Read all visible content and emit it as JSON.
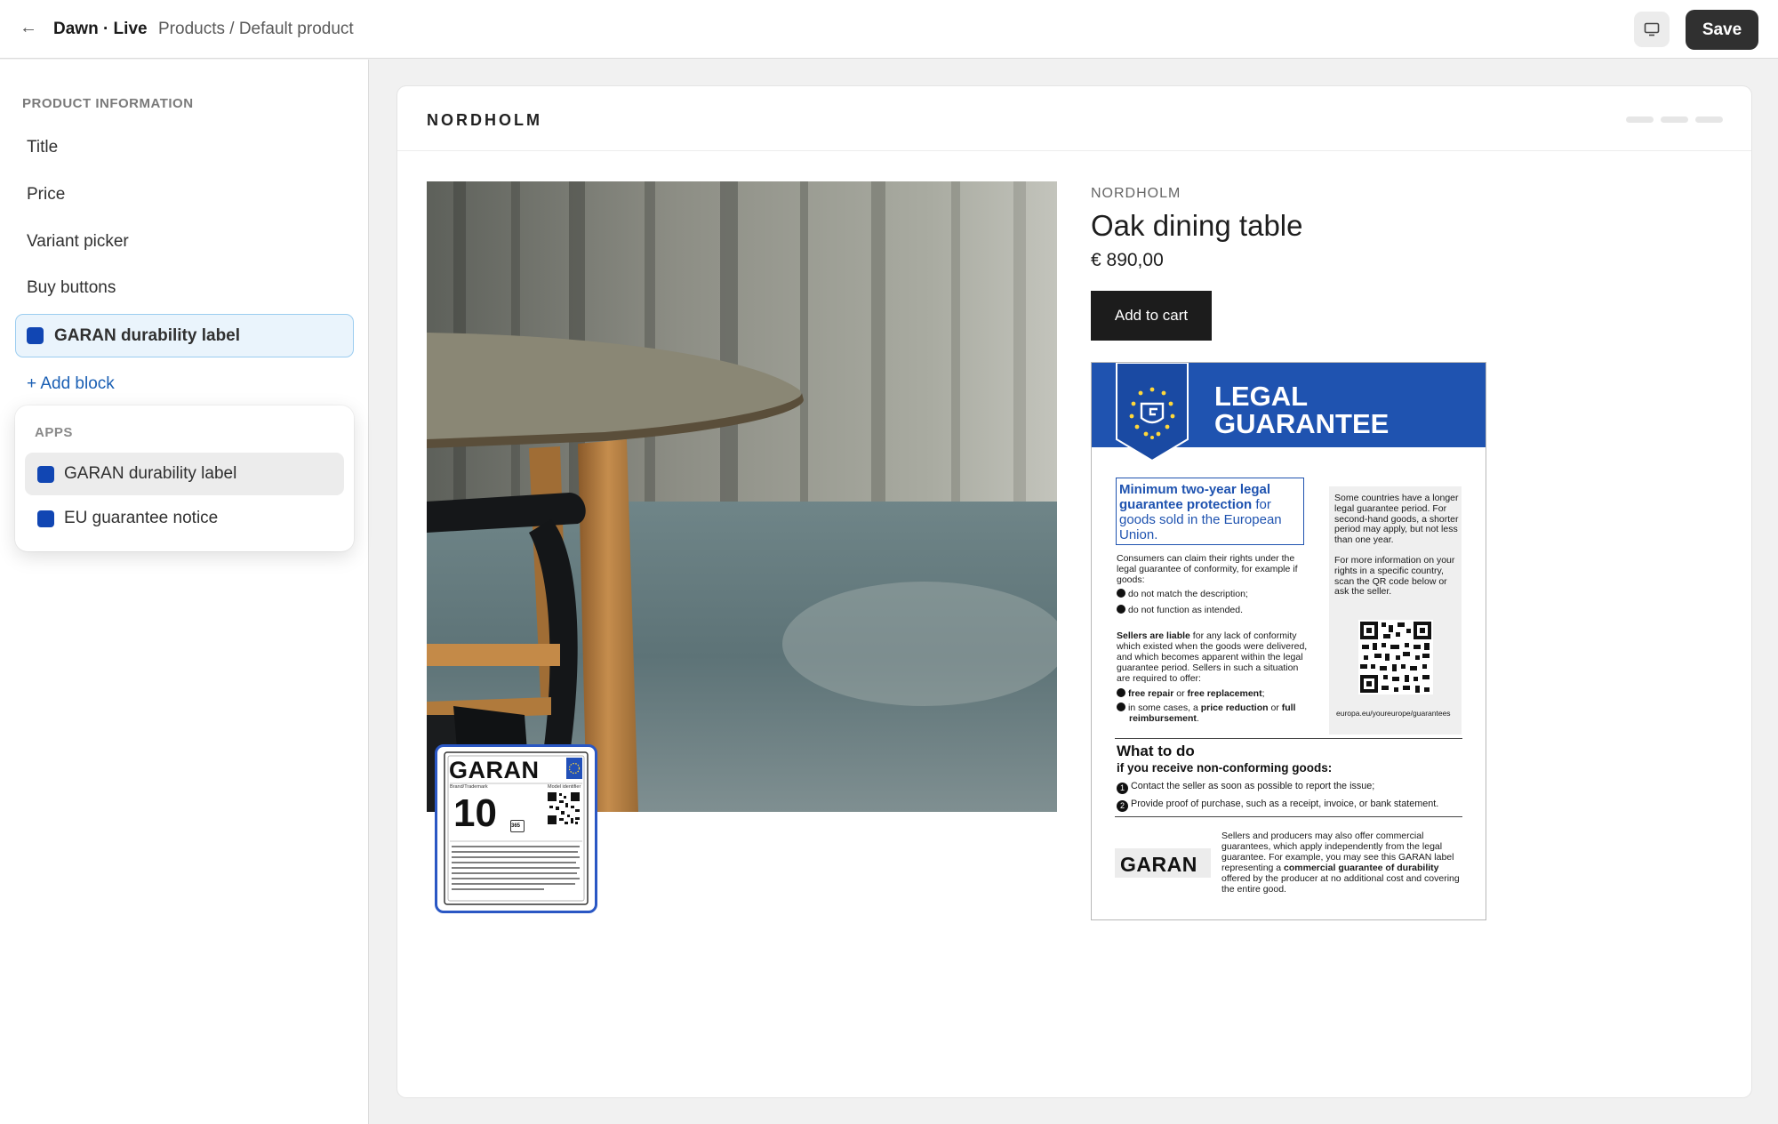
{
  "topbar": {
    "back_icon": "←",
    "store": "Dawn · Live",
    "breadcrumb": "Products / Default product",
    "device_icon": "desktop-icon",
    "save_label": "Save"
  },
  "sidebar": {
    "section_title": "PRODUCT INFORMATION",
    "items": [
      "Title",
      "Price",
      "Variant picker",
      "Buy buttons"
    ],
    "selected_block": "GARAN durability label",
    "add_block": "+ Add block",
    "popover": {
      "title": "APPS",
      "items": [
        "GARAN durability label",
        "EU guarantee notice"
      ]
    },
    "app_color": "#1146b3"
  },
  "preview": {
    "brand": "NORDHOLM",
    "vendor": "NORDHOLM",
    "product_title": "Oak dining table",
    "price": "€ 890,00",
    "add_to_cart": "Add to cart",
    "badge": {
      "logo": "GARAN",
      "brand_label": "Brand/Trademark",
      "model_label": "Model identifier",
      "years": "10",
      "days": "365"
    },
    "legal": {
      "title_line1": "LEGAL",
      "title_line2": "GUARANTEE",
      "headline_bold": "Minimum two-year legal guarantee protection",
      "headline_rest": " for goods sold in the European Union.",
      "consumers": "Consumers can claim their rights under the legal guarantee of conformity, for example if goods:",
      "check1": "do not match the description;",
      "check2": "do not function as intended.",
      "sellers_bold": "Sellers are liable",
      "sellers_rest": " for any lack of conformity which existed when the goods were delivered, and which becomes apparent within the legal guarantee period. Sellers in such a situation are required to offer:",
      "offer1_a": "free repair",
      "offer1_b": " or ",
      "offer1_c": "free replacement",
      "offer1_d": ";",
      "offer2_a": "in some cases, a ",
      "offer2_b": "price reduction",
      "offer2_c": " or ",
      "offer2_d": "full reimbursement",
      "offer2_e": ".",
      "right_p1": "Some countries have a longer legal guarantee period. For second-hand goods, a shorter period may apply, but not less than one year.",
      "right_p2": "For more information on your rights in a specific country, scan the QR code below or ask the seller.",
      "url": "europa.eu/youreurope/guarantees",
      "what_to_do": "What to do",
      "what_sub": "if you receive non-conforming goods:",
      "step1": "Contact the seller as soon as possible to report the issue;",
      "step2": "Provide proof of purchase, such as a receipt, invoice, or bank statement.",
      "garan_logo": "GARAN",
      "bottom_a": "Sellers and producers may also offer commercial guarantees, which apply independently from the legal guarantee. For example, you may see this GARAN label representing a ",
      "bottom_b": "commercial guarantee of durability",
      "bottom_c": " offered by the producer at no additional cost and covering the entire good."
    }
  },
  "colors": {
    "eu_blue": "#1f53b0",
    "selected_bg": "#eaf4fc",
    "link": "#1a5fb4"
  }
}
